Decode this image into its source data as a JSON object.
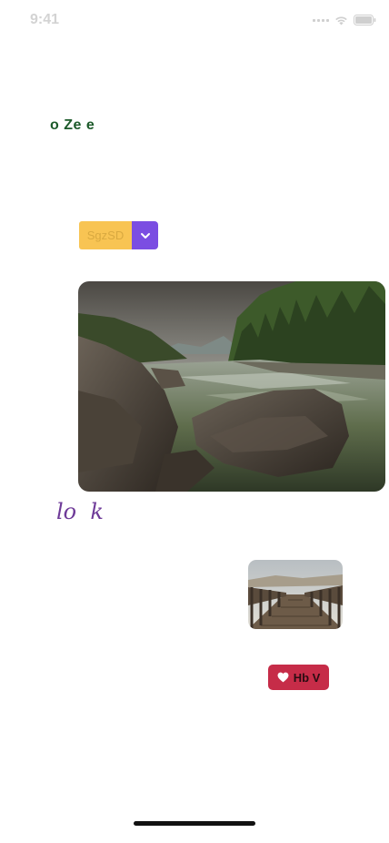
{
  "status_bar": {
    "time": "9:41",
    "icons": [
      "signal-icon",
      "wifi-icon",
      "battery-icon"
    ]
  },
  "heading": {
    "text": "o Ze e",
    "color": "#1c5a2a"
  },
  "split_button": {
    "label": "SgzSD",
    "main_color": "#f8c453",
    "toggle_color": "#7b4de2",
    "toggle_icon": "chevron-down-icon"
  },
  "images": {
    "river": "river-landscape-image",
    "bridge": "wooden-bridge-image"
  },
  "italic_text": {
    "text": "lo  k",
    "color": "#6e3a98"
  },
  "like_button": {
    "label": "Hb V",
    "icon": "heart-icon",
    "color": "#c62c48"
  }
}
